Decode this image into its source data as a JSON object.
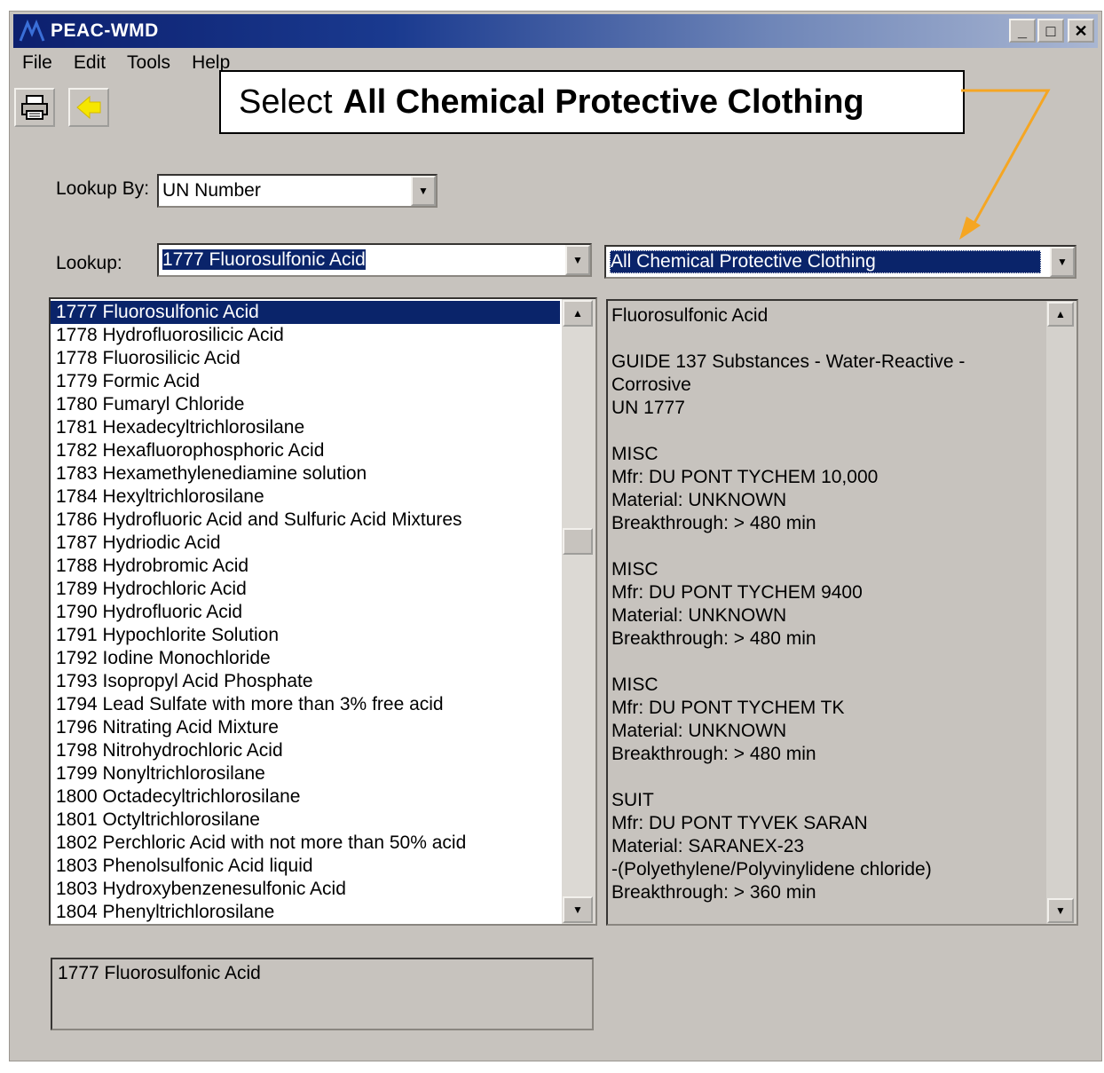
{
  "window": {
    "title": "PEAC-WMD",
    "controls": {
      "minimize": "_",
      "maximize": "□",
      "close": "✕"
    }
  },
  "menu": [
    "File",
    "Edit",
    "Tools",
    "Help"
  ],
  "toolbar": {
    "print_icon": "printer-icon",
    "back_icon": "back-arrow-icon"
  },
  "callout": {
    "prefix": "Select",
    "bold": "All Chemical Protective Clothing",
    "arrow_color": "#f5a623"
  },
  "lookup_by": {
    "label": "Lookup By:",
    "value": "UN Number"
  },
  "lookup": {
    "label": "Lookup:",
    "value": "1777 Fluorosulfonic Acid"
  },
  "category": {
    "value": "All Chemical Protective Clothing"
  },
  "chemicals": {
    "selected_index": 0,
    "items": [
      "1777 Fluorosulfonic Acid",
      "1778 Hydrofluorosilicic Acid",
      "1778 Fluorosilicic Acid",
      "1779 Formic Acid",
      "1780 Fumaryl Chloride",
      "1781 Hexadecyltrichlorosilane",
      "1782 Hexafluorophosphoric Acid",
      "1783 Hexamethylenediamine solution",
      "1784 Hexyltrichlorosilane",
      "1786 Hydrofluoric Acid and Sulfuric Acid Mixtures",
      "1787 Hydriodic Acid",
      "1788 Hydrobromic Acid",
      "1789 Hydrochloric Acid",
      "1790 Hydrofluoric Acid",
      "1791 Hypochlorite Solution",
      "1792 Iodine Monochloride",
      "1793 Isopropyl Acid Phosphate",
      "1794 Lead Sulfate with more than 3% free acid",
      "1796 Nitrating Acid Mixture",
      "1798 Nitrohydrochloric Acid",
      "1799 Nonyltrichlorosilane",
      "1800 Octadecyltrichlorosilane",
      "1801 Octyltrichlorosilane",
      "1802 Perchloric Acid with not more than 50% acid",
      "1803 Phenolsulfonic Acid liquid",
      "1803 Hydroxybenzenesulfonic Acid",
      "1804 Phenyltrichlorosilane"
    ]
  },
  "details": {
    "lines": [
      "Fluorosulfonic Acid",
      "",
      "GUIDE 137 Substances - Water-Reactive -",
      "Corrosive",
      "UN 1777",
      "",
      "MISC",
      "Mfr: DU PONT TYCHEM 10,000",
      "Material: UNKNOWN",
      "Breakthrough: > 480 min",
      "",
      "MISC",
      "Mfr: DU PONT TYCHEM 9400",
      "Material: UNKNOWN",
      "Breakthrough: > 480 min",
      "",
      "MISC",
      "Mfr: DU PONT TYCHEM TK",
      "Material: UNKNOWN",
      "Breakthrough: > 480 min",
      "",
      "SUIT",
      "Mfr: DU PONT TYVEK SARAN",
      "Material: SARANEX-23",
      "-(Polyethylene/Polyvinylidene chloride)",
      "Breakthrough: > 360 min"
    ]
  },
  "selected_summary": "1777 Fluorosulfonic Acid"
}
